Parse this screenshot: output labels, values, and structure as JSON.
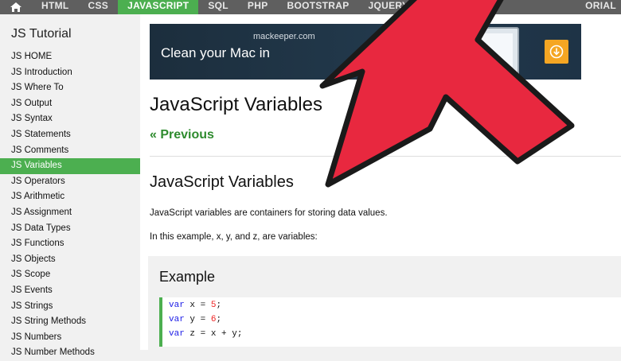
{
  "topnav": {
    "items": [
      {
        "label": "HTML",
        "active": false
      },
      {
        "label": "CSS",
        "active": false
      },
      {
        "label": "JAVASCRIPT",
        "active": true
      },
      {
        "label": "SQL",
        "active": false
      },
      {
        "label": "PHP",
        "active": false
      },
      {
        "label": "BOOTSTRAP",
        "active": false
      },
      {
        "label": "JQUERY",
        "active": false
      }
    ],
    "right_label": "ORIAL",
    "home_icon": "home-icon",
    "active_color": "#4caf50"
  },
  "sidebar": {
    "title": "JS Tutorial",
    "items": [
      "JS HOME",
      "JS Introduction",
      "JS Where To",
      "JS Output",
      "JS Syntax",
      "JS Statements",
      "JS Comments",
      "JS Variables",
      "JS Operators",
      "JS Arithmetic",
      "JS Assignment",
      "JS Data Types",
      "JS Functions",
      "JS Objects",
      "JS Scope",
      "JS Events",
      "JS Strings",
      "JS String Methods",
      "JS Numbers",
      "JS Number Methods"
    ],
    "active_index": 7
  },
  "ad": {
    "domain": "mackeeper.com",
    "headline": "Clean your Mac in",
    "button_icon": "download-icon"
  },
  "main": {
    "page_title": "JavaScript Variables",
    "prev_link": "« Previous",
    "section_title": "JavaScript Variables",
    "para1": "JavaScript variables are containers for storing data values.",
    "para2": "In this example, x, y, and z, are variables:",
    "example_title": "Example",
    "code": [
      {
        "kw": "var",
        "rest": " x = ",
        "num": "5",
        "end": ";"
      },
      {
        "kw": "var",
        "rest": " y = ",
        "num": "6",
        "end": ";"
      },
      {
        "kw": "var",
        "rest": " z = x + y;",
        "num": "",
        "end": ""
      }
    ]
  },
  "overlay": {
    "arrow_icon": "red-arrow-pointer",
    "arrow_color": "#e8283f"
  }
}
